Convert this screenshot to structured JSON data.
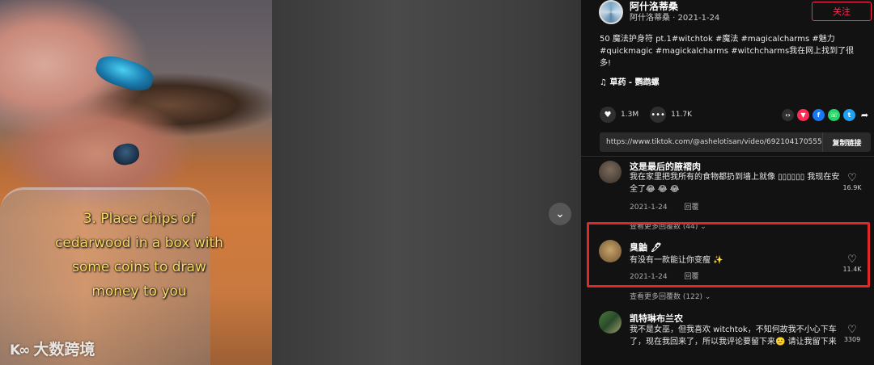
{
  "video": {
    "caption_lines": [
      "3. Place chips of",
      "cedarwood in a box with",
      "some coins to draw",
      "money to you"
    ],
    "watermark": "大数跨境",
    "watermark_logo": "K∞",
    "nav_down_icon": "chevron-down-icon"
  },
  "author": {
    "name": "阿什洛蒂桑",
    "sub": "阿什洛蒂桑 · 2021-1-24",
    "follow_label": "关注"
  },
  "description": {
    "text": "50 魔法护身符 pt.1#witchtok #魔法 #magicalcharms #魅力 #quickmagic #magickalcharms #witchcharms我在网上找到了很多!"
  },
  "music": {
    "icon": "♫",
    "label": "草药 - 鹦鹉螺"
  },
  "stats": {
    "likes": "1.3M",
    "comments": "11.7K"
  },
  "share": {
    "icons": [
      "embed-icon",
      "share-icon",
      "facebook-icon",
      "whatsapp-icon",
      "twitter-icon",
      "forward-icon"
    ],
    "url": "https://www.tiktok.com/@ashelotisan/video/692104170555...",
    "copy_label": "复制链接"
  },
  "comments": [
    {
      "name": "这是最后的腋褶肉",
      "text": "我在家里把我所有的食物都扔到墙上就像 ▯▯▯▯▯▯ 我现在安全了😂 😂 😂",
      "date": "2021-1-24",
      "reply": "回覆",
      "likes": "16.9K",
      "more": "查看更多回覆数 (44) ⌄"
    },
    {
      "name": "臭鼬 🖊",
      "text": "有没有一款能让你变瘦 ✨",
      "date": "2021-1-24",
      "reply": "回覆",
      "likes": "11.4K",
      "more": "查看更多回覆数 (122) ⌄"
    },
    {
      "name": "凯特琳布兰农",
      "text": "我不是女巫，但我喜欢 witchtok，不知何故我不小心下车了，现在我回来了，所以我评论要留下来🙂 请让我留下来",
      "likes": "3309"
    }
  ],
  "colors": {
    "accent": "#fe2c55",
    "highlight": "#e02828",
    "caption": "#f6dc62"
  }
}
